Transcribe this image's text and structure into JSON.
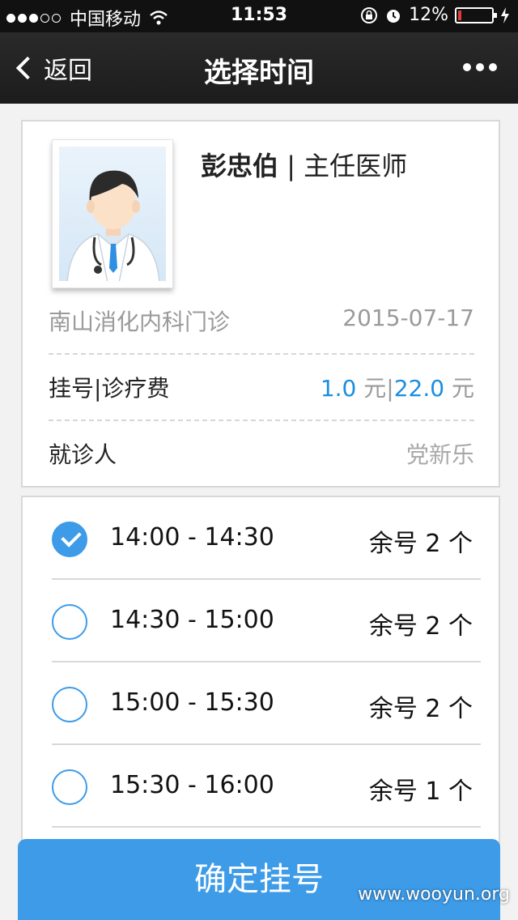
{
  "status_bar": {
    "carrier": "中国移动",
    "time": "11:53",
    "battery": "12%",
    "battery_level": 0.12
  },
  "nav": {
    "back_label": "返回",
    "title": "选择时间"
  },
  "doctor": {
    "name": "彭忠伯",
    "title": "| 主任医师",
    "department": "南山消化内科门诊",
    "date": "2015-07-17",
    "fee_label": "挂号|诊疗费",
    "registration_fee": "1.0",
    "fee_unit": "元",
    "separator": "|",
    "treatment_fee": "22.0",
    "patient_label": "就诊人",
    "patient_name": "党新乐"
  },
  "slots": [
    {
      "time": "14:00 - 14:30",
      "remain": "余号 2 个",
      "checked": true
    },
    {
      "time": "14:30 - 15:00",
      "remain": "余号 2 个",
      "checked": false
    },
    {
      "time": "15:00 - 15:30",
      "remain": "余号 2 个",
      "checked": false
    },
    {
      "time": "15:30 - 16:00",
      "remain": "余号 1 个",
      "checked": false
    }
  ],
  "confirm_label": "确定挂号",
  "watermark": "www.wooyun.org",
  "colors": {
    "accent": "#3d9be8",
    "fee_blue": "#1a8ee0",
    "nav_bg": "#1c1c1c",
    "battery_low": "#e23b3b"
  }
}
